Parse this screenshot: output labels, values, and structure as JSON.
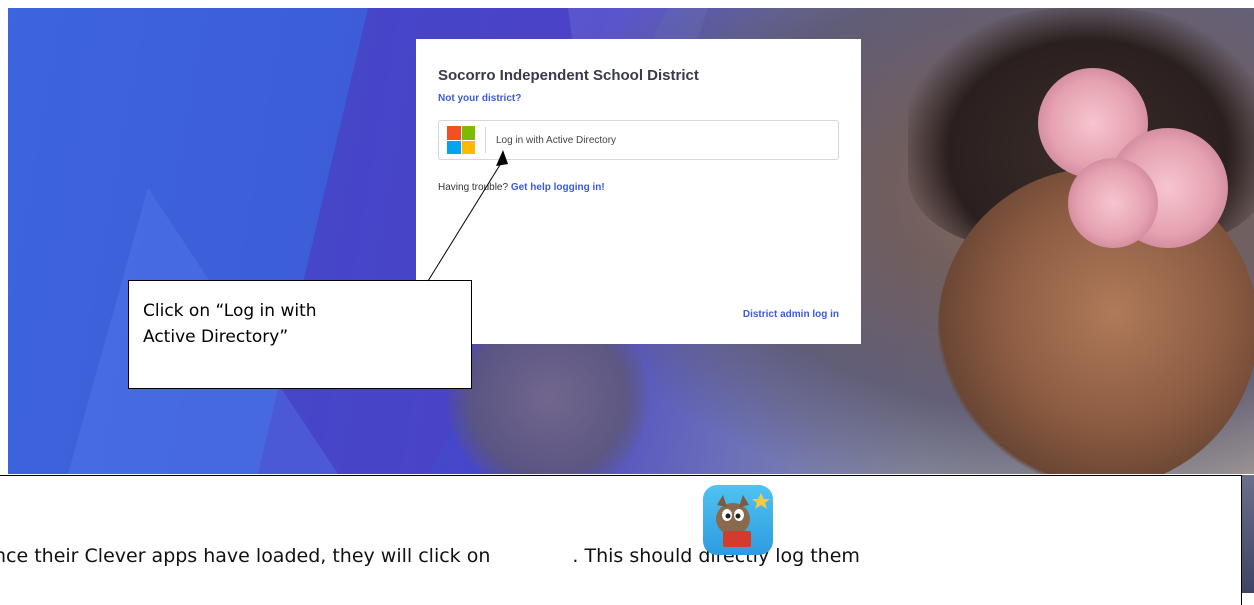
{
  "login": {
    "district_name": "Socorro Independent School District",
    "not_your_district": "Not your district?",
    "active_directory_button": "Log in with Active Directory",
    "trouble_text": "Having trouble?",
    "help_link": "Get help logging in!",
    "admin_link": "District admin log in"
  },
  "callout": {
    "line1": "Click on “Log in with",
    "line2": "Active Directory”"
  },
  "instructions": {
    "before_icon": "nce their Clever apps have loaded, they will click on",
    "after_icon": ". This should directly log them"
  },
  "colors": {
    "accent_link": "#3d5bd9",
    "ms_red": "#f25022",
    "ms_green": "#7fba00",
    "ms_blue": "#00a4ef",
    "ms_yellow": "#ffb900"
  },
  "icons": {
    "microsoft_logo": "microsoft-logo-icon",
    "app_icon": "squirrel-reading-app-icon"
  }
}
